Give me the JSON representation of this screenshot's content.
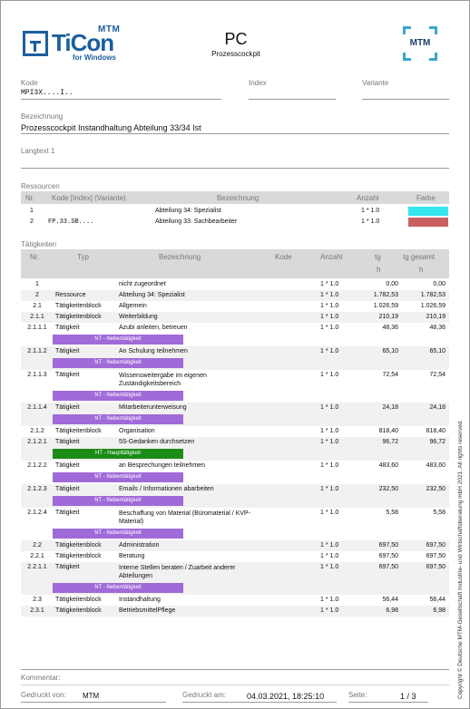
{
  "header": {
    "logo_name": "TiCon",
    "logo_mtm": "MTM",
    "logo_sub": "for Windows",
    "title": "PC",
    "subtitle": "Prozesscockpit",
    "mtm_logo": "MTM"
  },
  "fields": {
    "kode_label": "Kode",
    "kode_value": "MPI3X....I..",
    "index_label": "Index",
    "index_value": "",
    "variante_label": "Variante",
    "variante_value": "",
    "bezeichnung_label": "Bezeichnung",
    "bezeichnung_value": "Prozesscockpit Instandhaltung Abteilung 33/34 Ist",
    "langtext_label": "Langtext 1",
    "langtext_value": ""
  },
  "ressourcen": {
    "title": "Ressourcen",
    "columns": [
      "Nr.",
      "Kode [Index] (Variante)",
      "Bezeichnung",
      "Anzahl",
      "Farbe"
    ],
    "rows": [
      {
        "nr": "1",
        "kode": "",
        "bez": "Abteilung 34: Spezialist",
        "anzahl": "1 * 1.0",
        "farbe": "#33e6f0"
      },
      {
        "nr": "2",
        "kode": "FP.33.SB....",
        "bez": "Abteilung 33: Sachbearbeiter",
        "anzahl": "1 * 1.0",
        "farbe": "#c86060"
      }
    ]
  },
  "taetigkeiten": {
    "title": "Tätigkeiten",
    "columns": {
      "nr": "Nr.",
      "typ": "Typ",
      "bez": "Bezeichnung",
      "kode": "Kode",
      "anzahl": "Anzahl",
      "tg1": "tg",
      "tg2": "h",
      "tgg1": "tg gesamt",
      "tgg2": "h"
    },
    "rows": [
      {
        "nr": "1",
        "typ": "",
        "bez": "nicht zugeordnet",
        "anzahl": "1 * 1.0",
        "tg": "0,00",
        "tgg": "0,00",
        "badge": null
      },
      {
        "nr": "2",
        "typ": "Ressource",
        "bez": "Abteilung 34: Spezialist",
        "anzahl": "1 * 1.0",
        "tg": "1.782,53",
        "tgg": "1.782,53",
        "badge": null
      },
      {
        "nr": "2.1",
        "typ": "Tätigkeitenblock",
        "bez": "Allgemein",
        "anzahl": "1 * 1.0",
        "tg": "1.026,59",
        "tgg": "1.026,59",
        "badge": null
      },
      {
        "nr": "2.1.1",
        "typ": "Tätigkeitenblock",
        "bez": "Weiterbildung",
        "anzahl": "1 * 1.0",
        "tg": "210,19",
        "tgg": "210,19",
        "badge": null
      },
      {
        "nr": "2.1.1.1",
        "typ": "Tätigkeit",
        "bez": "Azubi anleiten, betreuen",
        "anzahl": "1 * 1.0",
        "tg": "48,36",
        "tgg": "48,36",
        "badge": "NT - Nebentätigkeit"
      },
      {
        "nr": "2.1.1.2",
        "typ": "Tätigkeit",
        "bez": "An Schulung teilnehmen",
        "anzahl": "1 * 1.0",
        "tg": "65,10",
        "tgg": "65,10",
        "badge": "NT - Nebentätigkeit"
      },
      {
        "nr": "2.1.1.3",
        "typ": "Tätigkeit",
        "bez": "Wissensweitergabe im eigenen Zuständigkeitsbereich",
        "anzahl": "1 * 1.0",
        "tg": "72,54",
        "tgg": "72,54",
        "badge": "NT - Nebentätigkeit"
      },
      {
        "nr": "2.1.1.4",
        "typ": "Tätigkeit",
        "bez": "Mitarbeiterunterweisung",
        "anzahl": "1 * 1.0",
        "tg": "24,18",
        "tgg": "24,18",
        "badge": "NT - Nebentätigkeit"
      },
      {
        "nr": "2.1.2",
        "typ": "Tätigkeitenblock",
        "bez": "Organisation",
        "anzahl": "1 * 1.0",
        "tg": "818,40",
        "tgg": "818,40",
        "badge": null
      },
      {
        "nr": "2.1.2.1",
        "typ": "Tätigkeit",
        "bez": "5S-Gedanken durchsetzen",
        "anzahl": "1 * 1.0",
        "tg": "96,72",
        "tgg": "96,72",
        "badge": "HT - Haupttätigkeit"
      },
      {
        "nr": "2.1.2.2",
        "typ": "Tätigkeit",
        "bez": "an Besprechungen teilnehmen",
        "anzahl": "1 * 1.0",
        "tg": "483,60",
        "tgg": "483,60",
        "badge": "NT - Nebentätigkeit"
      },
      {
        "nr": "2.1.2.3",
        "typ": "Tätigkeit",
        "bez": "Emails / Informationen abarbeiten",
        "anzahl": "1 * 1.0",
        "tg": "232,50",
        "tgg": "232,50",
        "badge": "NT - Nebentätigkeit"
      },
      {
        "nr": "2.1.2.4",
        "typ": "Tätigkeit",
        "bez": "Beschaffung von Material (Büromaterial / KVP-Material)",
        "anzahl": "1 * 1.0",
        "tg": "5,58",
        "tgg": "5,58",
        "badge": "NT - Nebentätigkeit"
      },
      {
        "nr": "2.2",
        "typ": "Tätigkeitenblock",
        "bez": "Administration",
        "anzahl": "1 * 1.0",
        "tg": "697,50",
        "tgg": "697,50",
        "badge": null
      },
      {
        "nr": "2.2.1",
        "typ": "Tätigkeitenblock",
        "bez": "Beratung",
        "anzahl": "1 * 1.0",
        "tg": "697,50",
        "tgg": "697,50",
        "badge": null
      },
      {
        "nr": "2.2.1.1",
        "typ": "Tätigkeit",
        "bez": "Interne Stellen beraten / Zuarbeit anderer Abteilungen",
        "anzahl": "1 * 1.0",
        "tg": "697,50",
        "tgg": "697,50",
        "badge": "NT - Nebentätigkeit"
      },
      {
        "nr": "2.3",
        "typ": "Tätigkeitenblock",
        "bez": "Instandhaltung",
        "anzahl": "1 * 1.0",
        "tg": "56,44",
        "tgg": "56,44",
        "badge": null
      },
      {
        "nr": "2.3.1",
        "typ": "Tätigkeitenblock",
        "bez": "BetriebsmittelPflege",
        "anzahl": "1 * 1.0",
        "tg": "6,98",
        "tgg": "6,98",
        "badge": null
      }
    ]
  },
  "footer": {
    "kommentar_label": "Kommentar:",
    "gedruckt_von_label": "Gedruckt von:",
    "gedruckt_von": "MTM",
    "gedruckt_am_label": "Gedruckt am:",
    "gedruckt_am": "04.03.2021, 18:25:10",
    "seite_label": "Seite:",
    "seite": "1 / 3",
    "copyright": "Copyright © Deutsche MTM-Gesellschaft Industrie- und Wirtschaftsberatung mbH 2021. All rights reserved."
  },
  "colors": {
    "nt": "#a06ad9",
    "ht": "#1c8c17",
    "accent": "#1b5f9e"
  }
}
